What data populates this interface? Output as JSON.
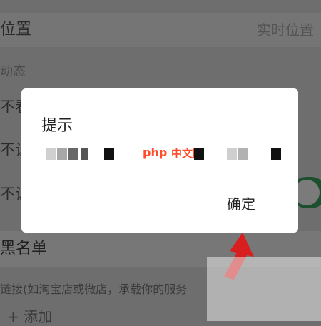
{
  "background": {
    "title_left": "位置",
    "title_right": "实时位置",
    "section": "动态",
    "setting1": "不看",
    "setting2": "不让",
    "setting3": "不让",
    "blacklist": "黑名单",
    "hint": "链接(如淘宝店或微店，承载你的服务",
    "add": "+ 添加"
  },
  "dialog": {
    "title": "提示",
    "ok_label": "确定",
    "watermark_php": "php",
    "watermark_cn": "中文网"
  },
  "colors": {
    "overlay": "#6e6e6e",
    "dialog_bg": "#ffffff",
    "watermark": "#ff4c2b",
    "toggle": "#1c4f2e",
    "arrow": "#d81e1e"
  }
}
